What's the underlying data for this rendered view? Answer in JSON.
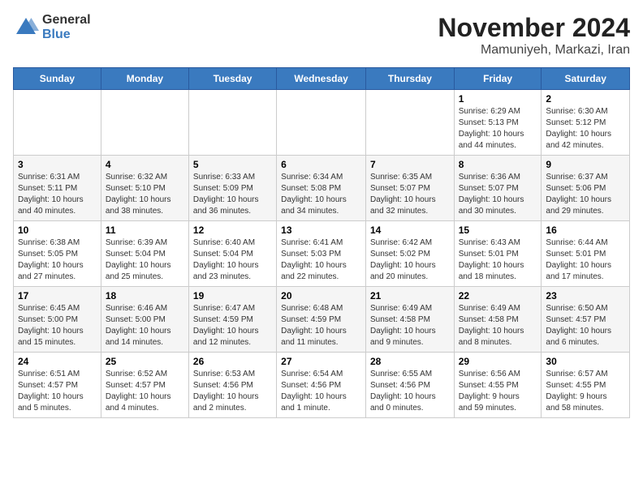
{
  "logo": {
    "general": "General",
    "blue": "Blue"
  },
  "title": "November 2024",
  "location": "Mamuniyeh, Markazi, Iran",
  "days_of_week": [
    "Sunday",
    "Monday",
    "Tuesday",
    "Wednesday",
    "Thursday",
    "Friday",
    "Saturday"
  ],
  "weeks": [
    [
      {
        "num": "",
        "info": ""
      },
      {
        "num": "",
        "info": ""
      },
      {
        "num": "",
        "info": ""
      },
      {
        "num": "",
        "info": ""
      },
      {
        "num": "",
        "info": ""
      },
      {
        "num": "1",
        "info": "Sunrise: 6:29 AM\nSunset: 5:13 PM\nDaylight: 10 hours\nand 44 minutes."
      },
      {
        "num": "2",
        "info": "Sunrise: 6:30 AM\nSunset: 5:12 PM\nDaylight: 10 hours\nand 42 minutes."
      }
    ],
    [
      {
        "num": "3",
        "info": "Sunrise: 6:31 AM\nSunset: 5:11 PM\nDaylight: 10 hours\nand 40 minutes."
      },
      {
        "num": "4",
        "info": "Sunrise: 6:32 AM\nSunset: 5:10 PM\nDaylight: 10 hours\nand 38 minutes."
      },
      {
        "num": "5",
        "info": "Sunrise: 6:33 AM\nSunset: 5:09 PM\nDaylight: 10 hours\nand 36 minutes."
      },
      {
        "num": "6",
        "info": "Sunrise: 6:34 AM\nSunset: 5:08 PM\nDaylight: 10 hours\nand 34 minutes."
      },
      {
        "num": "7",
        "info": "Sunrise: 6:35 AM\nSunset: 5:07 PM\nDaylight: 10 hours\nand 32 minutes."
      },
      {
        "num": "8",
        "info": "Sunrise: 6:36 AM\nSunset: 5:07 PM\nDaylight: 10 hours\nand 30 minutes."
      },
      {
        "num": "9",
        "info": "Sunrise: 6:37 AM\nSunset: 5:06 PM\nDaylight: 10 hours\nand 29 minutes."
      }
    ],
    [
      {
        "num": "10",
        "info": "Sunrise: 6:38 AM\nSunset: 5:05 PM\nDaylight: 10 hours\nand 27 minutes."
      },
      {
        "num": "11",
        "info": "Sunrise: 6:39 AM\nSunset: 5:04 PM\nDaylight: 10 hours\nand 25 minutes."
      },
      {
        "num": "12",
        "info": "Sunrise: 6:40 AM\nSunset: 5:04 PM\nDaylight: 10 hours\nand 23 minutes."
      },
      {
        "num": "13",
        "info": "Sunrise: 6:41 AM\nSunset: 5:03 PM\nDaylight: 10 hours\nand 22 minutes."
      },
      {
        "num": "14",
        "info": "Sunrise: 6:42 AM\nSunset: 5:02 PM\nDaylight: 10 hours\nand 20 minutes."
      },
      {
        "num": "15",
        "info": "Sunrise: 6:43 AM\nSunset: 5:01 PM\nDaylight: 10 hours\nand 18 minutes."
      },
      {
        "num": "16",
        "info": "Sunrise: 6:44 AM\nSunset: 5:01 PM\nDaylight: 10 hours\nand 17 minutes."
      }
    ],
    [
      {
        "num": "17",
        "info": "Sunrise: 6:45 AM\nSunset: 5:00 PM\nDaylight: 10 hours\nand 15 minutes."
      },
      {
        "num": "18",
        "info": "Sunrise: 6:46 AM\nSunset: 5:00 PM\nDaylight: 10 hours\nand 14 minutes."
      },
      {
        "num": "19",
        "info": "Sunrise: 6:47 AM\nSunset: 4:59 PM\nDaylight: 10 hours\nand 12 minutes."
      },
      {
        "num": "20",
        "info": "Sunrise: 6:48 AM\nSunset: 4:59 PM\nDaylight: 10 hours\nand 11 minutes."
      },
      {
        "num": "21",
        "info": "Sunrise: 6:49 AM\nSunset: 4:58 PM\nDaylight: 10 hours\nand 9 minutes."
      },
      {
        "num": "22",
        "info": "Sunrise: 6:49 AM\nSunset: 4:58 PM\nDaylight: 10 hours\nand 8 minutes."
      },
      {
        "num": "23",
        "info": "Sunrise: 6:50 AM\nSunset: 4:57 PM\nDaylight: 10 hours\nand 6 minutes."
      }
    ],
    [
      {
        "num": "24",
        "info": "Sunrise: 6:51 AM\nSunset: 4:57 PM\nDaylight: 10 hours\nand 5 minutes."
      },
      {
        "num": "25",
        "info": "Sunrise: 6:52 AM\nSunset: 4:57 PM\nDaylight: 10 hours\nand 4 minutes."
      },
      {
        "num": "26",
        "info": "Sunrise: 6:53 AM\nSunset: 4:56 PM\nDaylight: 10 hours\nand 2 minutes."
      },
      {
        "num": "27",
        "info": "Sunrise: 6:54 AM\nSunset: 4:56 PM\nDaylight: 10 hours\nand 1 minute."
      },
      {
        "num": "28",
        "info": "Sunrise: 6:55 AM\nSunset: 4:56 PM\nDaylight: 10 hours\nand 0 minutes."
      },
      {
        "num": "29",
        "info": "Sunrise: 6:56 AM\nSunset: 4:55 PM\nDaylight: 9 hours\nand 59 minutes."
      },
      {
        "num": "30",
        "info": "Sunrise: 6:57 AM\nSunset: 4:55 PM\nDaylight: 9 hours\nand 58 minutes."
      }
    ]
  ]
}
